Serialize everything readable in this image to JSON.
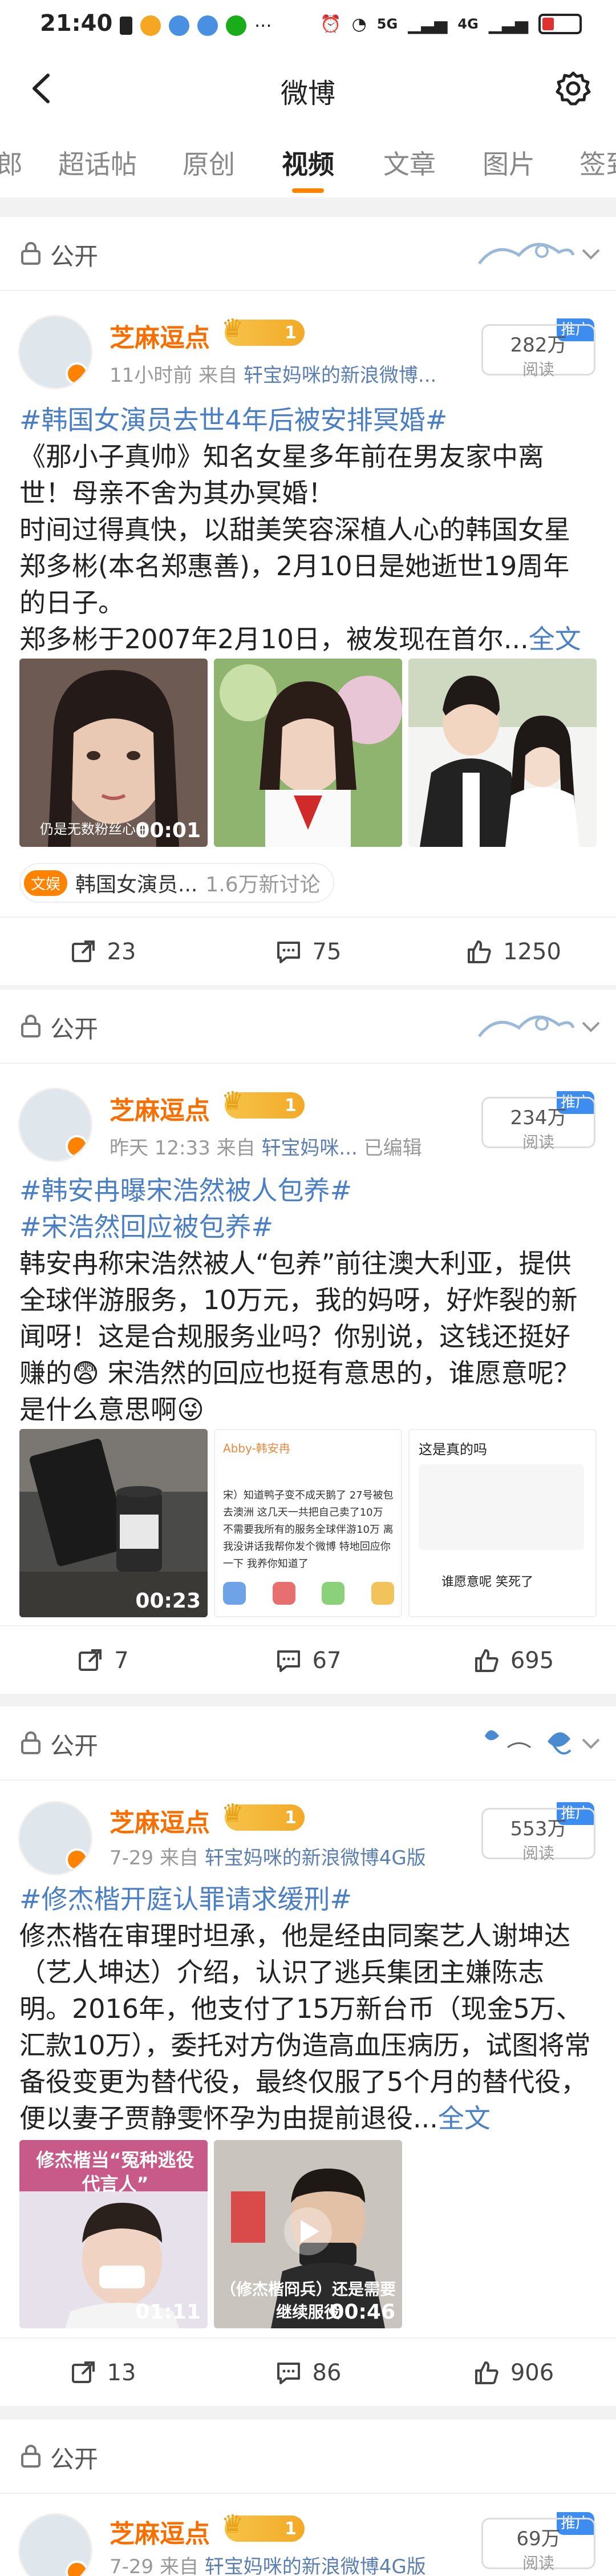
{
  "status_bar": {
    "time": "21:40",
    "network": "5G",
    "network2": "4G"
  },
  "nav": {
    "title": "微博"
  },
  "tabs": [
    {
      "label": "郎"
    },
    {
      "label": "超话帖"
    },
    {
      "label": "原创"
    },
    {
      "label": "视频"
    },
    {
      "label": "文章"
    },
    {
      "label": "图片"
    },
    {
      "label": "签到"
    }
  ],
  "colors": {
    "accent": "#ff8200",
    "link": "#4a7fc4",
    "username": "#f86e00"
  },
  "posts": [
    {
      "visibility": "公开",
      "username": "芝麻逗点",
      "vip_level": "1",
      "time": "11小时前",
      "source_prefix": "来自",
      "source": "轩宝妈咪的新浪微博...",
      "reads": "282万",
      "reads_label": "阅读",
      "promo": "推广",
      "topic": "#韩国女演员去世4年后被安排冥婚#",
      "text": "《那小子真帅》知名女星多年前在男友家中离世！母亲不舍为其办冥婚！\n时间过得真快，以甜美笑容深植人心的韩国女星郑多彬(本名郑惠善)，2月10日是她逝世19周年的日子。\n郑多彬于2007年2月10日，被发现在首尔...",
      "more": "全文",
      "thumbs": [
        {
          "duration": "00:01",
          "caption": "仍是无数粉丝心中"
        },
        {
          "duration": ""
        },
        {
          "duration": ""
        }
      ],
      "chip": {
        "tag": "文娱",
        "name": "韩国女演员...",
        "discussion": "1.6万新讨论"
      },
      "reposts": "23",
      "comments": "75",
      "likes": "1250"
    },
    {
      "visibility": "公开",
      "username": "芝麻逗点",
      "vip_level": "1",
      "time": "昨天 12:33",
      "source_prefix": "来自",
      "source": "轩宝妈咪...",
      "edited": "已编辑",
      "reads": "234万",
      "reads_label": "阅读",
      "promo": "推广",
      "topic": "#韩安冉曝宋浩然被人包养#",
      "topic2": "#宋浩然回应被包养#",
      "text": "韩安冉称宋浩然被人“包养”前往澳大利亚，提供全球伴游服务，10万元，我的妈呀，好炸裂的新闻呀！这是合规服务业吗？你别说，这钱还挺好赚的😨 宋浩然的回应也挺有意思的，谁愿意呢？是什么意思啊😜",
      "thumbs": [
        {
          "duration": "00:23"
        },
        {
          "duration": "",
          "snippet_name": "Abby-韩安冉",
          "snippet_text": "宋）知道鸭子变不成天鹅了 27号被包去澳洲  这几天一共把自己卖了10万 不需要我所有的服务全球伴游10万 离我没讲话我帮你发个微博 特地回应你一下 我养你知道了"
        },
        {
          "duration": "",
          "snippet_title": "这是真的吗",
          "snippet_text": "谁愿意呢 笑死了"
        }
      ],
      "reposts": "7",
      "comments": "67",
      "likes": "695"
    },
    {
      "visibility": "公开",
      "username": "芝麻逗点",
      "vip_level": "1",
      "time": "7-29",
      "source_prefix": "来自",
      "source": "轩宝妈咪的新浪微博4G版",
      "reads": "553万",
      "reads_label": "阅读",
      "promo": "推广",
      "topic": "#修杰楷开庭认罪请求缓刑#",
      "text": "修杰楷在审理时坦承，他是经由同案艺人谢坤达（艺人坤达）介绍，认识了逃兵集团主嫌陈志明。2016年，他支付了15万新台币（现金5万、汇款10万），委托对方伪造高血压病历，试图将常备役变更为替代役，最终仅服了5个月的替代役，便以妻子贾静雯怀孕为由提前退役...",
      "more": "全文",
      "thumbs": [
        {
          "duration": "01:11",
          "caption": "修杰楷当“冤种逃役代言人”"
        },
        {
          "duration": "00:46",
          "caption": "（修杰楷冏兵）还是需要继续服役"
        }
      ],
      "reposts": "13",
      "comments": "86",
      "likes": "906"
    },
    {
      "visibility": "公开",
      "username": "芝麻逗点",
      "vip_level": "1",
      "time": "7-29",
      "source_prefix": "来自",
      "source": "轩宝妈咪的新浪微博4G版",
      "reads": "69万",
      "reads_label": "阅读",
      "promo": "推广"
    }
  ]
}
